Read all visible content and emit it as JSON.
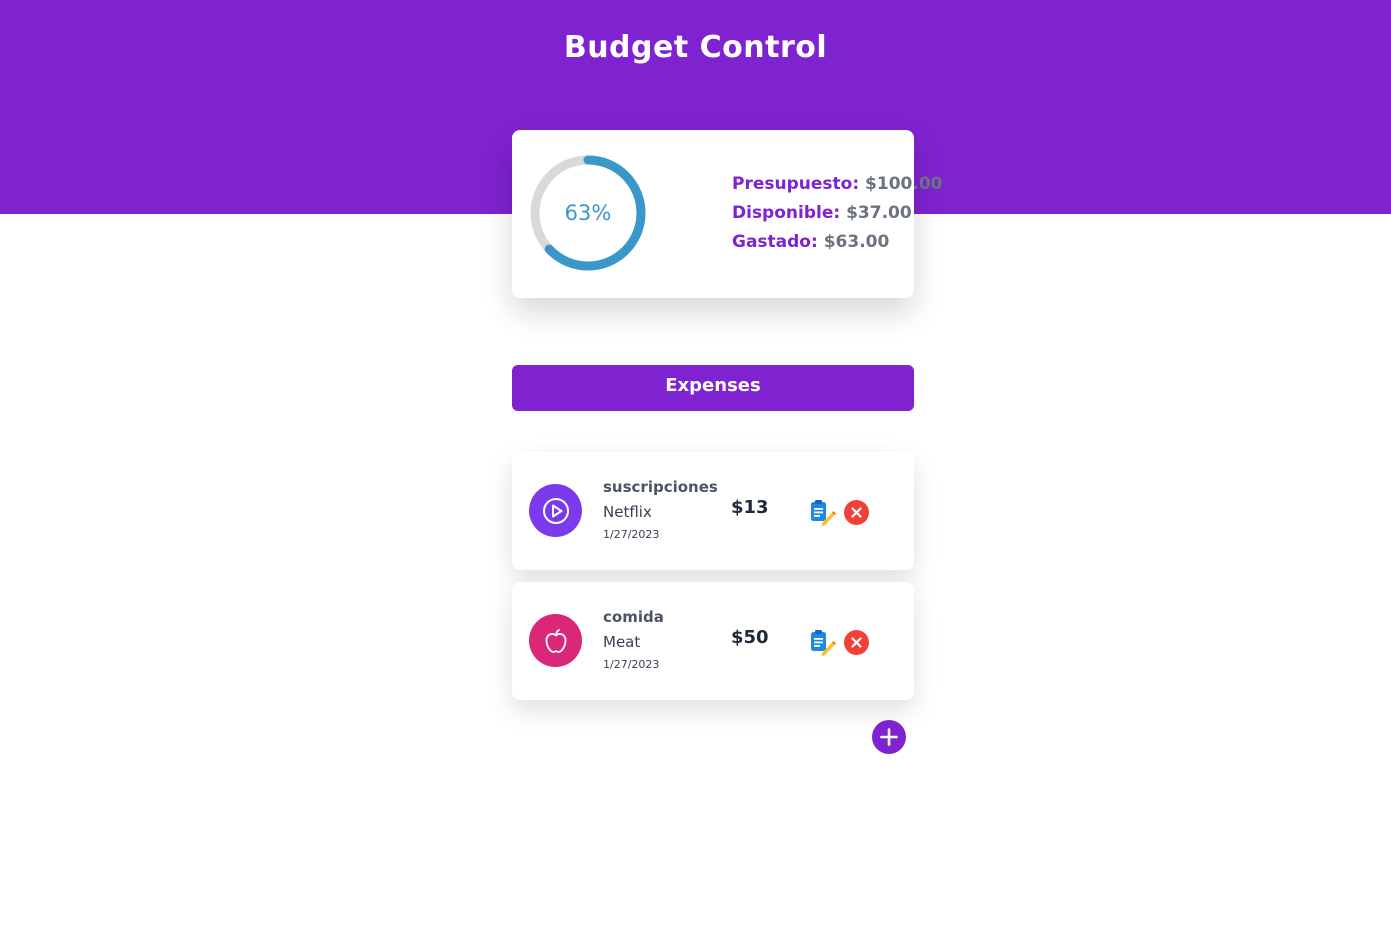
{
  "app": {
    "title": "Budget Control"
  },
  "colors": {
    "brand": "#7f22d0",
    "progress": "#3b97c9",
    "progress_track": "#d9d9d9",
    "delete": "#ef4138",
    "subscriptions_icon_bg": "#7c3aed",
    "food_icon_bg": "#db2777"
  },
  "budget": {
    "progress_percent": 63,
    "progress_label": "63%",
    "stats": [
      {
        "label": "Presupuesto:",
        "value": "$100.00"
      },
      {
        "label": "Disponible:",
        "value": "$37.00"
      },
      {
        "label": "Gastado:",
        "value": "$63.00"
      }
    ]
  },
  "expenses": {
    "header": "Expenses",
    "items": [
      {
        "category": "suscripciones",
        "name": "Netflix",
        "date": "1/27/2023",
        "amount": "$13",
        "icon": "play-circle-icon"
      },
      {
        "category": "comida",
        "name": "Meat",
        "date": "1/27/2023",
        "amount": "$50",
        "icon": "apple-icon"
      }
    ]
  },
  "actions": {
    "edit_icon": "clipboard-edit-icon",
    "delete_icon": "close-icon",
    "add_icon": "plus-icon"
  }
}
